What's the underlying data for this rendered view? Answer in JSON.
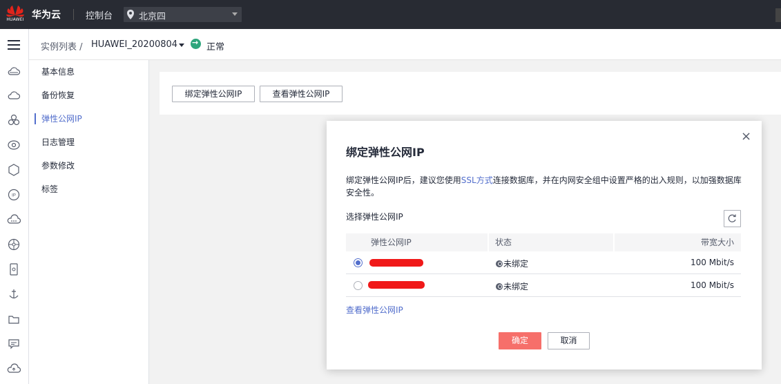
{
  "topbar": {
    "logo_text": "HUAWEI",
    "brand": "华为云",
    "console": "控制台",
    "region": "北京四"
  },
  "rail": {
    "icons": [
      "menu-icon",
      "cloud-icon",
      "cloud-outline-icon",
      "cluster-icon",
      "eye-icon",
      "hexagon-icon",
      "ip-icon",
      "cloud-dots-icon",
      "network-icon",
      "storage-icon",
      "anchor-icon",
      "folder-icon",
      "chat-icon",
      "cloud-upload-icon"
    ]
  },
  "breadcrumb": {
    "list": "实例列表 /",
    "instance": "HUAWEI_20200804",
    "status": "正常"
  },
  "subnav": {
    "items": [
      {
        "label": "基本信息"
      },
      {
        "label": "备份恢复"
      },
      {
        "label": "弹性公网IP"
      },
      {
        "label": "日志管理"
      },
      {
        "label": "参数修改"
      },
      {
        "label": "标签"
      }
    ],
    "active_index": 2
  },
  "content": {
    "bind_button": "绑定弹性公网IP",
    "view_button": "查看弹性公网IP"
  },
  "dialog": {
    "title": "绑定弹性公网IP",
    "desc_before": "绑定弹性公网IP后，建议您使用",
    "desc_link": "SSL方式",
    "desc_after": "连接数据库，并在内网安全组中设置严格的出入规则，以加强数据库安全性。",
    "select_label": "选择弹性公网IP",
    "columns": [
      "弹性公网IP",
      "状态",
      "带宽大小"
    ],
    "rows": [
      {
        "selected": true,
        "ip": "",
        "status": "未绑定",
        "bandwidth": "100 Mbit/s"
      },
      {
        "selected": false,
        "ip": "",
        "status": "未绑定",
        "bandwidth": "100 Mbit/s"
      }
    ],
    "view_link": "查看弹性公网IP",
    "ok": "确定",
    "cancel": "取消"
  },
  "colors": {
    "topbar": "#282b33",
    "accent": "#526ecc",
    "primary_button": "#f66f6a",
    "status_ok": "#2ea57c",
    "redaction": "#f01919"
  }
}
